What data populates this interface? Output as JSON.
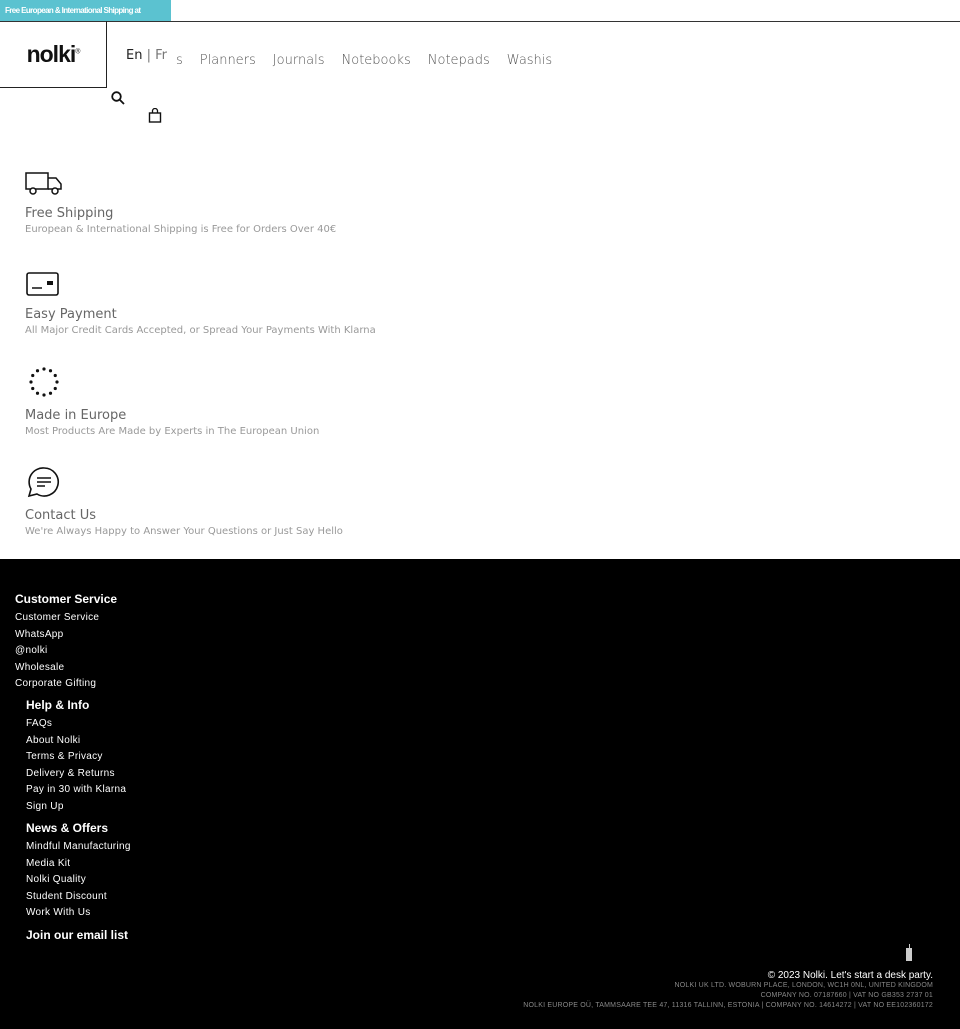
{
  "banner": {
    "text": "Free European & International Shipping at"
  },
  "header": {
    "logo": "nolki",
    "lang_en": "En",
    "lang_sep": " | ",
    "lang_fr": "Fr",
    "nav": [
      "s",
      "Planners",
      "Journals",
      "Notebooks",
      "Notepads",
      "Washis"
    ]
  },
  "features": [
    {
      "icon": "truck-icon",
      "title": "Free Shipping",
      "desc": "European & International Shipping is Free for Orders Over 40€"
    },
    {
      "icon": "credit-card-icon",
      "title": "Easy Payment",
      "desc": "All Major Credit Cards Accepted, or Spread Your Payments With Klarna"
    },
    {
      "icon": "eu-stars-icon",
      "title": "Made in Europe",
      "desc": "Most Products Are Made by Experts in The European Union"
    },
    {
      "icon": "chat-bubble-icon",
      "title": "Contact Us",
      "desc": "We're Always Happy to Answer Your Questions or Just Say Hello"
    }
  ],
  "footer": {
    "columns": [
      {
        "title": "Customer Service",
        "links": [
          "Customer Service",
          "WhatsApp",
          "@nolki",
          "Wholesale",
          "Corporate Gifting"
        ]
      },
      {
        "title": "Help & Info",
        "links": [
          "FAQs",
          "About Nolki",
          "Terms & Privacy",
          "Delivery & Returns",
          "Pay in 30 with Klarna",
          "Sign Up"
        ]
      },
      {
        "title": "News & Offers",
        "links": [
          "Mindful Manufacturing",
          "Media Kit",
          "Nolki Quality",
          "Student Discount",
          "Work With Us"
        ]
      }
    ],
    "email_title": "Join our email list",
    "copyright": "© 2023 Nolki. Let's start a desk party.",
    "legal": [
      "NOLKI UK LTD. WOBURN PLACE, LONDON, WC1H 0NL, UNITED KINGDOM",
      "COMPANY NO. 07187660 | VAT NO GB353 2737 01",
      "NOLKI EUROPE OÜ, TAMMSAARE TEE 47, 11316 TALLINN, ESTONIA | COMPANY NO. 14614272 | VAT NO EE102360172"
    ]
  }
}
